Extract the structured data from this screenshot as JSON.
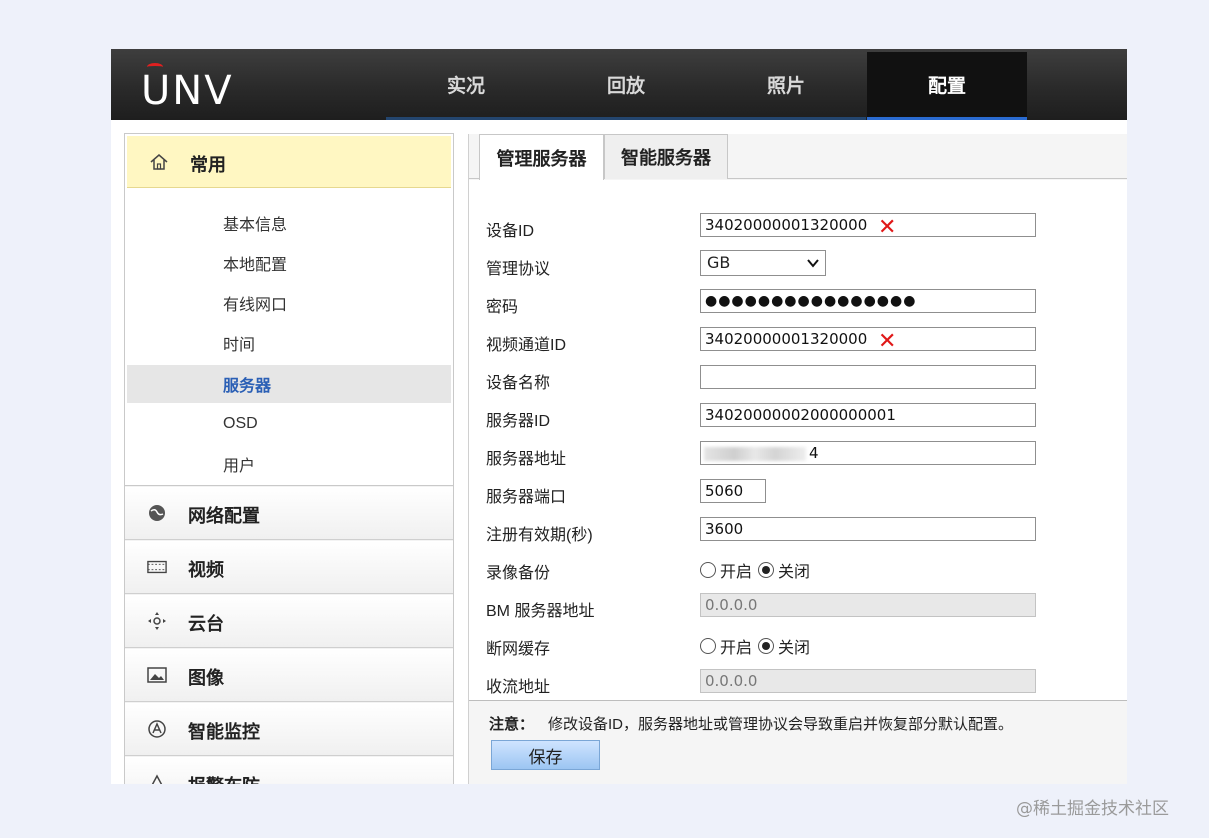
{
  "logo": {
    "text_before": "",
    "text_u": "U",
    "text_after": "NV"
  },
  "nav": {
    "tabs": [
      {
        "label": "实况",
        "active": false
      },
      {
        "label": "回放",
        "active": false
      },
      {
        "label": "照片",
        "active": false
      },
      {
        "label": "配置",
        "active": true
      }
    ]
  },
  "sidebar": {
    "common": {
      "label": "常用",
      "icon": "home-icon",
      "items": [
        {
          "label": "基本信息"
        },
        {
          "label": "本地配置"
        },
        {
          "label": "有线网口"
        },
        {
          "label": "时间"
        },
        {
          "label": "服务器",
          "active": true
        },
        {
          "label": "OSD"
        },
        {
          "label": "用户"
        }
      ]
    },
    "sections": [
      {
        "label": "网络配置",
        "icon": "network-globe-icon"
      },
      {
        "label": "视频",
        "icon": "video-film-icon"
      },
      {
        "label": "云台",
        "icon": "ptz-crosshair-icon"
      },
      {
        "label": "图像",
        "icon": "image-icon"
      },
      {
        "label": "智能监控",
        "icon": "smart-eye-icon"
      },
      {
        "label": "报警布防",
        "icon": "alarm-icon"
      }
    ]
  },
  "tabs": [
    {
      "label": "管理服务器",
      "active": true
    },
    {
      "label": "智能服务器",
      "active": false
    }
  ],
  "form": {
    "device_id": {
      "label": "设备ID",
      "value": "34020000001320000"
    },
    "protocol": {
      "label": "管理协议",
      "value": "GB"
    },
    "password": {
      "label": "密码",
      "value": "●●●●●●●●●●●●●●●●"
    },
    "channel_id": {
      "label": "视频通道ID",
      "value": "34020000001320000"
    },
    "device_name": {
      "label": "设备名称",
      "value": ""
    },
    "server_id": {
      "label": "服务器ID",
      "value": "34020000002000000001"
    },
    "server_addr": {
      "label": "服务器地址",
      "value": "4"
    },
    "server_port": {
      "label": "服务器端口",
      "value": "5060"
    },
    "register_expiry": {
      "label": "注册有效期(秒)",
      "value": "3600"
    },
    "record_backup": {
      "label": "录像备份",
      "on_label": "开启",
      "off_label": "关闭",
      "selected": "off"
    },
    "bm_server_addr": {
      "label": "BM 服务器地址",
      "value": "0.0.0.0"
    },
    "offline_cache": {
      "label": "断网缓存",
      "on_label": "开启",
      "off_label": "关闭",
      "selected": "off"
    },
    "stream_addr": {
      "label": "收流地址",
      "value": "0.0.0.0"
    }
  },
  "notice": {
    "title": "注意：",
    "text": "修改设备ID，服务器地址或管理协议会导致重启并恢复部分默认配置。"
  },
  "save_label": "保存",
  "watermark": "@稀土掘金技术社区",
  "colors": {
    "active_tab": "#111111",
    "selected_menu_text": "#2a5fb5",
    "common_header": "#fff7c2",
    "redaction_mark": "#e01818"
  }
}
